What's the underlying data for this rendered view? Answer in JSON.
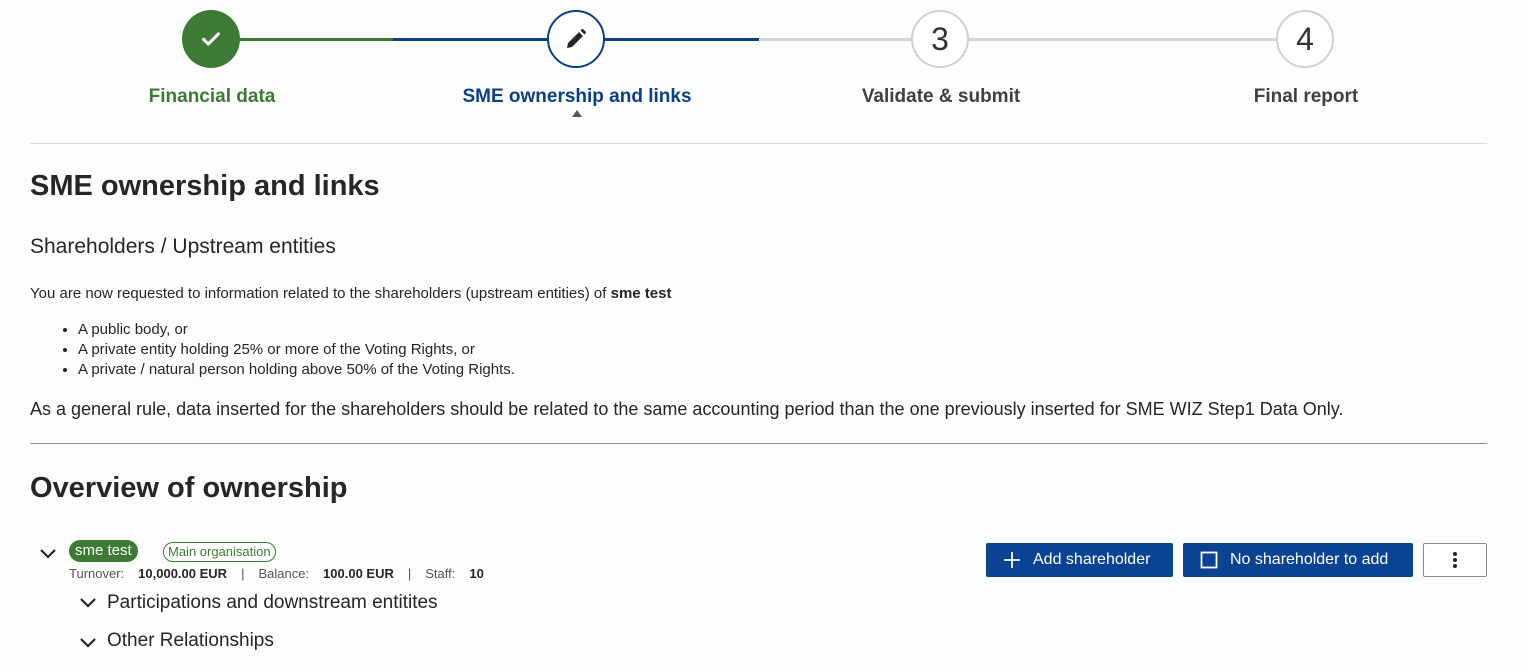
{
  "stepper": {
    "steps": [
      {
        "label": "Financial data",
        "state": "done",
        "icon": "check-icon"
      },
      {
        "label": "SME ownership and links",
        "state": "current",
        "icon": "pencil-icon"
      },
      {
        "label": "Validate & submit",
        "state": "todo",
        "number": "3"
      },
      {
        "label": "Final report",
        "state": "todo",
        "number": "4"
      }
    ]
  },
  "main": {
    "title": "SME ownership and links",
    "subtitle": "Shareholders / Upstream entities",
    "intro_text": "You are now requested to information related to the shareholders (upstream entities) of ",
    "intro_org": "sme test",
    "bullets": [
      "A public body, or",
      "A private entity holding 25% or more of the Voting Rights, or",
      "A private / natural person holding above 50% of the Voting Rights."
    ],
    "rule_text": "As a general rule, data inserted for the shareholders should be related to the same accounting period than the one previously inserted for SME WIZ Step1 Data Only."
  },
  "overview": {
    "title": "Overview of ownership",
    "org": {
      "name": "sme test",
      "tag": "Main organisation",
      "turnover_label": "Turnover:",
      "turnover_value": "10,000.00 EUR",
      "balance_label": "Balance:",
      "balance_value": "100.00 EUR",
      "staff_label": "Staff:",
      "staff_value": "10",
      "separator": "|"
    },
    "sections": [
      "Participations and downstream entitites",
      "Other Relationships"
    ],
    "buttons": {
      "add_shareholder": "Add shareholder",
      "no_shareholder": "No shareholder to add"
    }
  },
  "colors": {
    "done": "#3d7a36",
    "current": "#0b3f86",
    "primary_button": "#0b4394",
    "pending": "#d0d0d0"
  }
}
